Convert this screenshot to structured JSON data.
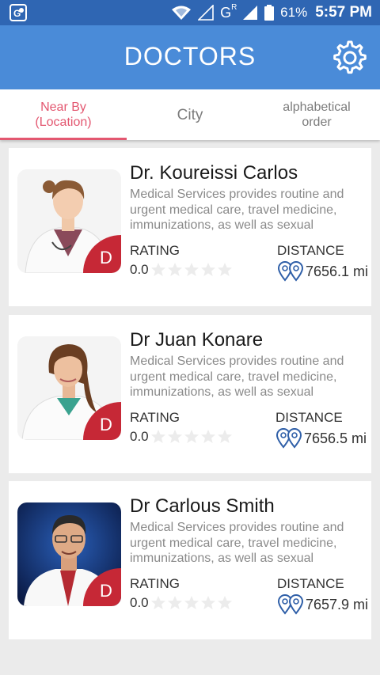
{
  "status_bar": {
    "battery_percent": "61%",
    "time": "5:57 PM",
    "network_label": "G",
    "network_superscript": "R"
  },
  "app_bar": {
    "title": "DOCTORS",
    "settings_icon": "gear-icon"
  },
  "tabs": [
    {
      "label": "Near By\n(Location)",
      "active": true
    },
    {
      "label": "City",
      "active": false
    },
    {
      "label": "alphabetical\norder",
      "active": false
    }
  ],
  "colors": {
    "status_bar": "#2f66b3",
    "app_bar": "#4a8bd8",
    "accent": "#e35770",
    "badge": "#c62836"
  },
  "doctors": [
    {
      "name": "Dr. Koureissi Carlos",
      "description": "Medical Services provides routine and urgent medical care, travel medicine, immunizations, as well as sexual",
      "rating_label": "RATING",
      "rating_value": "0.0",
      "stars_filled": 0,
      "distance_label": "DISTANCE",
      "distance": "7656.1 mi",
      "badge": "D"
    },
    {
      "name": "Dr Juan Konare",
      "description": "Medical Services provides routine and urgent medical care, travel medicine, immunizations, as well as sexual",
      "rating_label": "RATING",
      "rating_value": "0.0",
      "stars_filled": 0,
      "distance_label": "DISTANCE",
      "distance": "7656.5 mi",
      "badge": "D"
    },
    {
      "name": "Dr Carlous Smith",
      "description": "Medical Services provides routine and urgent medical care, travel medicine, immunizations, as well as sexual",
      "rating_label": "RATING",
      "rating_value": "0.0",
      "stars_filled": 0,
      "distance_label": "DISTANCE",
      "distance": "7657.9 mi",
      "badge": "D"
    }
  ]
}
